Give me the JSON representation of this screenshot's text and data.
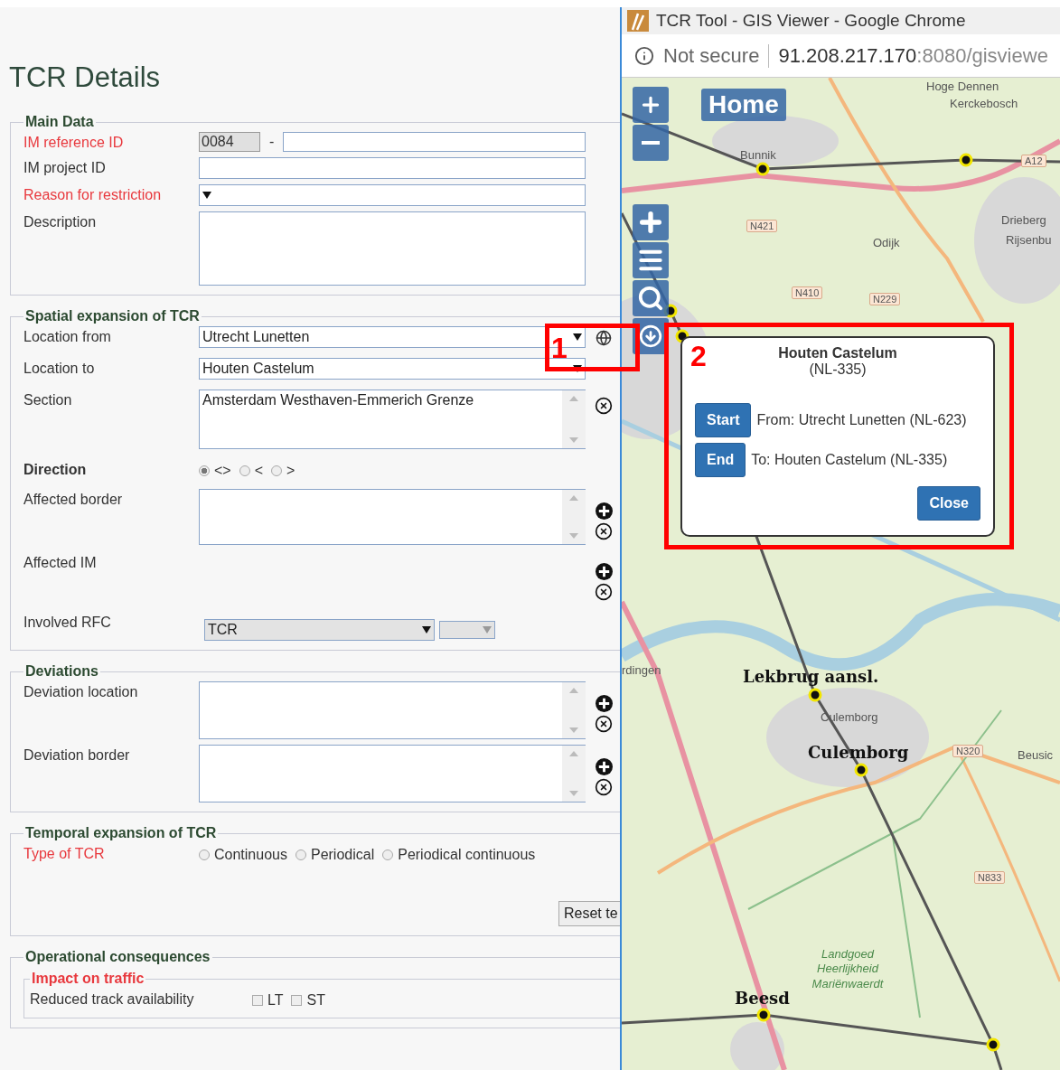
{
  "page_title": "TCR Details",
  "sections": [
    {
      "legend": "Main Data",
      "rows": [
        {
          "kind": "id_pair",
          "label": "IM reference ID",
          "required": true,
          "prefix": "0084",
          "separator": "-"
        },
        {
          "kind": "text",
          "label": "IM project ID",
          "required": false
        },
        {
          "kind": "select",
          "label": "Reason for restriction",
          "required": true
        },
        {
          "kind": "textarea",
          "label": "Description",
          "required": false
        }
      ]
    },
    {
      "legend": "Spatial expansion of TCR",
      "rows": [
        {
          "kind": "select_map",
          "label": "Location from",
          "required": false,
          "value": "Utrecht Lunetten"
        },
        {
          "kind": "select",
          "label": "Location to",
          "required": false,
          "value": "Houten Castelum"
        },
        {
          "kind": "list",
          "label": "Section",
          "required": false,
          "value": "Amsterdam Westhaven-Emmerich Grenze"
        },
        {
          "kind": "radios",
          "label": "Direction",
          "required": false,
          "bold": true,
          "options": [
            {
              "label": "<>",
              "selected": true
            },
            {
              "label": "<",
              "selected": false
            },
            {
              "label": ">",
              "selected": false
            }
          ]
        },
        {
          "kind": "list_editable",
          "label": "Affected border",
          "required": false
        },
        {
          "kind": "buttons",
          "label": "Affected IM",
          "required": false
        },
        {
          "kind": "rfc",
          "label": "Involved RFC",
          "required": false,
          "value": "TCR"
        }
      ]
    },
    {
      "legend": "Deviations",
      "rows": [
        {
          "kind": "list_editable",
          "label": "Deviation location",
          "required": false
        },
        {
          "kind": "list_editable",
          "label": "Deviation border",
          "required": false
        }
      ]
    },
    {
      "legend": "Temporal expansion of TCR",
      "rows": [
        {
          "kind": "radios",
          "label": "Type of TCR",
          "required": true,
          "options": [
            {
              "label": "Continuous",
              "selected": false
            },
            {
              "label": "Periodical",
              "selected": false
            },
            {
              "label": "Periodical continuous",
              "selected": false
            }
          ]
        }
      ],
      "button": "Reset te"
    },
    {
      "legend": "Operational consequences",
      "subsections": [
        {
          "legend": "Impact on traffic",
          "required": true,
          "rows": [
            {
              "kind": "checks",
              "label": "Reduced track availability",
              "required": false,
              "options": [
                {
                  "label": "LT",
                  "checked": false
                },
                {
                  "label": "ST",
                  "checked": false
                }
              ]
            }
          ]
        }
      ]
    }
  ],
  "browser": {
    "title": "TCR Tool - GIS Viewer - Google Chrome",
    "security": "Not secure",
    "url_host": "91.208.217.170",
    "url_path": ":8080/gisviewe"
  },
  "map": {
    "home": "Home",
    "labels": [
      {
        "text": "Hoge Dennen",
        "kind": "place"
      },
      {
        "text": "Kerckebosch",
        "kind": "place"
      },
      {
        "text": "Bunnik",
        "kind": "place"
      },
      {
        "text": "A12",
        "kind": "road"
      },
      {
        "text": "Drieberg",
        "kind": "place"
      },
      {
        "text": "N421",
        "kind": "road"
      },
      {
        "text": "Rijsenbu",
        "kind": "place"
      },
      {
        "text": "Odijk",
        "kind": "place"
      },
      {
        "text": "N410",
        "kind": "road"
      },
      {
        "text": "N229",
        "kind": "road"
      },
      {
        "text": "rdingen",
        "kind": "place"
      },
      {
        "text": "Lekbrug aansl.",
        "kind": "station"
      },
      {
        "text": "Culemborg",
        "kind": "place"
      },
      {
        "text": "Culemborg",
        "kind": "station"
      },
      {
        "text": "N320",
        "kind": "road"
      },
      {
        "text": "Beusic",
        "kind": "place"
      },
      {
        "text": "N833",
        "kind": "road"
      },
      {
        "text": "Landgoed Heerlijkheid Mariënwaerdt",
        "kind": "nature"
      },
      {
        "text": "Beesd",
        "kind": "station"
      }
    ],
    "popup": {
      "title": "Houten Castelum",
      "code": "(NL-335)",
      "rows": [
        {
          "button": "Start",
          "text": "From: Utrecht Lunetten (NL-623)"
        },
        {
          "button": "End",
          "text": "To: Houten Castelum (NL-335)"
        }
      ],
      "close": "Close"
    }
  },
  "annotations": [
    "1",
    "2"
  ]
}
